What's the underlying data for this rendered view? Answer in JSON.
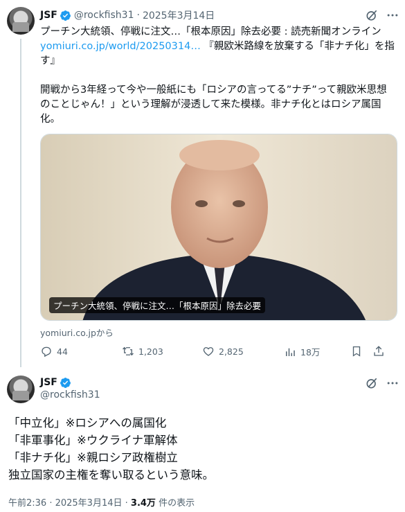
{
  "tweet1": {
    "author_name": "JSF",
    "author_handle": "@rockfish31",
    "separator": "·",
    "date": "2025年3月14日",
    "text_line1": "プーチン大統領、停戦に注文…「根本原因」除去必要 : 読売新聞オンライン",
    "link_text": "yomiuri.co.jp/world/20250314…",
    "text_line2_rest": " 『親欧米路線を放棄する「非ナチ化」を指",
    "text_line3": "す』",
    "text_line4": "開戦から3年経って今や一般紙にも「ロシアの言ってる”ナチ”って親欧米思想",
    "text_line5": "のことじゃん！」という理解が浸透して来た模様。非ナチ化とはロシア属国",
    "text_line6": "化。",
    "card_caption": "プーチン大統領、停戦に注文…「根本原因」除去必要",
    "card_source": "yomiuri.co.jpから",
    "replies": "44",
    "reposts": "1,203",
    "likes": "2,825",
    "views": "18万"
  },
  "tweet2": {
    "author_name": "JSF",
    "author_handle": "@rockfish31",
    "lines": [
      "「中立化」※ロシアへの属国化",
      "「非軍事化」※ウクライナ軍解体",
      "「非ナチ化」※親ロシア政権樹立",
      "独立国家の主権を奪い取るという意味。"
    ],
    "time": "午前2:36 · 2025年3月14日 ·",
    "views_count": "3.4万",
    "views_label": " 件の表示"
  },
  "icons": {
    "verified": "verified-badge-icon",
    "grok": "grok-icon",
    "more": "more-dots-icon",
    "reply": "reply-icon",
    "repost": "repost-icon",
    "like": "like-icon",
    "views": "views-icon",
    "bookmark": "bookmark-icon"
  },
  "colors": {
    "accent": "#1d9bf0",
    "muted": "#536471",
    "text": "#0f1419"
  }
}
